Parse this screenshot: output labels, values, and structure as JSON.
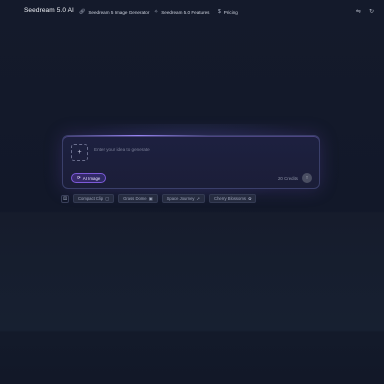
{
  "nav": {
    "brand": "Seedream 5.0 AI",
    "links": [
      {
        "label": "Seedream 5 Image Generator",
        "icon": "link-icon"
      },
      {
        "label": "Seedream 5.0 Features",
        "icon": "sparkle-icon"
      },
      {
        "label": "Pricing",
        "icon": "dollar-icon"
      }
    ],
    "icons": [
      "translate-icon",
      "refresh-icon"
    ]
  },
  "composer": {
    "upload_symbol": "+",
    "prompt_placeholder": "Enter your idea to generate",
    "mode_label": "AI Image",
    "credits": "20 Credits",
    "send_symbol": "↑"
  },
  "chips": [
    "Compact Clip",
    "Grass Dome",
    "Space Journey",
    "Cherry Blossoms"
  ],
  "colors": {
    "background": "#141a2b",
    "accent": "#7c5ad8",
    "panel": "#1d2040"
  }
}
